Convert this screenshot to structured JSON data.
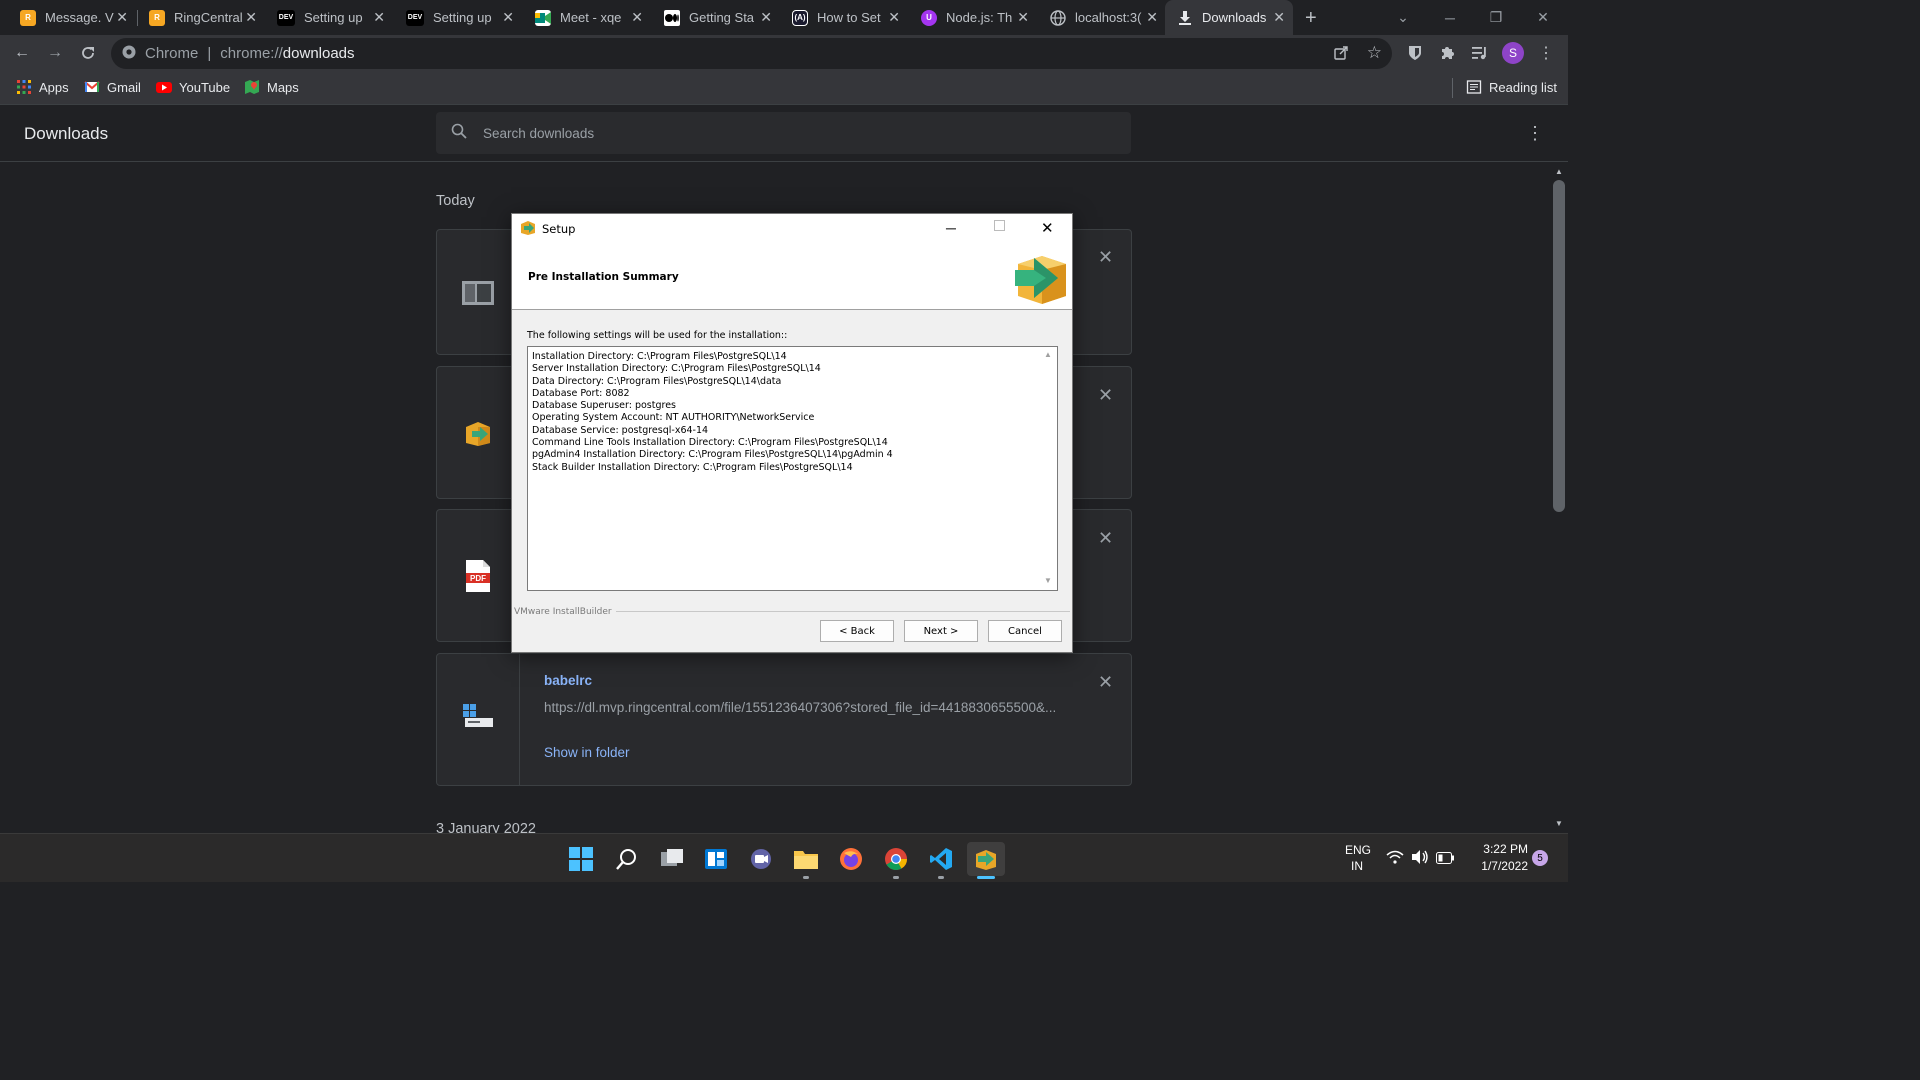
{
  "tabs": [
    {
      "title": "Message. V",
      "favicon": "ringcentral-icon",
      "color": "#f6a723"
    },
    {
      "title": "RingCentral",
      "favicon": "ringcentral-icon",
      "color": "#f6a723"
    },
    {
      "title": "Setting up",
      "favicon": "dev-icon",
      "color": "#000000"
    },
    {
      "title": "Setting up",
      "favicon": "dev-icon",
      "color": "#000000"
    },
    {
      "title": "Meet - xqe",
      "favicon": "meet-icon",
      "color": "#00897b"
    },
    {
      "title": "Getting Sta",
      "favicon": "medium-icon",
      "color": "#000000"
    },
    {
      "title": "How to Set",
      "favicon": "appwrite-icon",
      "color": "#1a1a2e"
    },
    {
      "title": "Node.js: Th",
      "favicon": "udemy-icon",
      "color": "#a435f0"
    },
    {
      "title": "localhost:3(",
      "favicon": "globe-icon",
      "color": "#5f6368"
    },
    {
      "title": "Downloads",
      "favicon": "download-icon",
      "color": "#35363a"
    }
  ],
  "omnibox": {
    "scheme": "Chrome",
    "separator": "|",
    "url_prefix": "chrome://",
    "url_path": "downloads"
  },
  "profile_initial": "S",
  "bookmarks": [
    {
      "label": "Apps",
      "icon": "apps-grid-icon"
    },
    {
      "label": "Gmail",
      "icon": "gmail-icon"
    },
    {
      "label": "YouTube",
      "icon": "youtube-icon"
    },
    {
      "label": "Maps",
      "icon": "maps-icon"
    }
  ],
  "reading_list": "Reading list",
  "downloads": {
    "title": "Downloads",
    "search_placeholder": "Search downloads",
    "section_today": "Today",
    "section_older": "3 January 2022",
    "babelrc": {
      "name": "babelrc",
      "url": "https://dl.mvp.ringcentral.com/file/1551236407306?stored_file_id=4418830655500&...",
      "action": "Show in folder"
    }
  },
  "dialog": {
    "title": "Setup",
    "heading": "Pre Installation Summary",
    "intro": "The following settings will be used for the installation::",
    "lines": [
      "Installation Directory: C:\\Program Files\\PostgreSQL\\14",
      "Server Installation Directory: C:\\Program Files\\PostgreSQL\\14",
      "Data Directory: C:\\Program Files\\PostgreSQL\\14\\data",
      "Database Port: 8082",
      "Database Superuser: postgres",
      "Operating System Account: NT AUTHORITY\\NetworkService",
      "Database Service: postgresql-x64-14",
      "Command Line Tools Installation Directory: C:\\Program Files\\PostgreSQL\\14",
      "pgAdmin4 Installation Directory: C:\\Program Files\\PostgreSQL\\14\\pgAdmin 4",
      "Stack Builder Installation Directory: C:\\Program Files\\PostgreSQL\\14"
    ],
    "brand": "VMware InstallBuilder",
    "back": "< Back",
    "next": "Next >",
    "cancel": "Cancel"
  },
  "taskbar": {
    "lang_line1": "ENG",
    "lang_line2": "IN",
    "time": "3:22 PM",
    "date": "1/7/2022",
    "notification_count": "5"
  }
}
